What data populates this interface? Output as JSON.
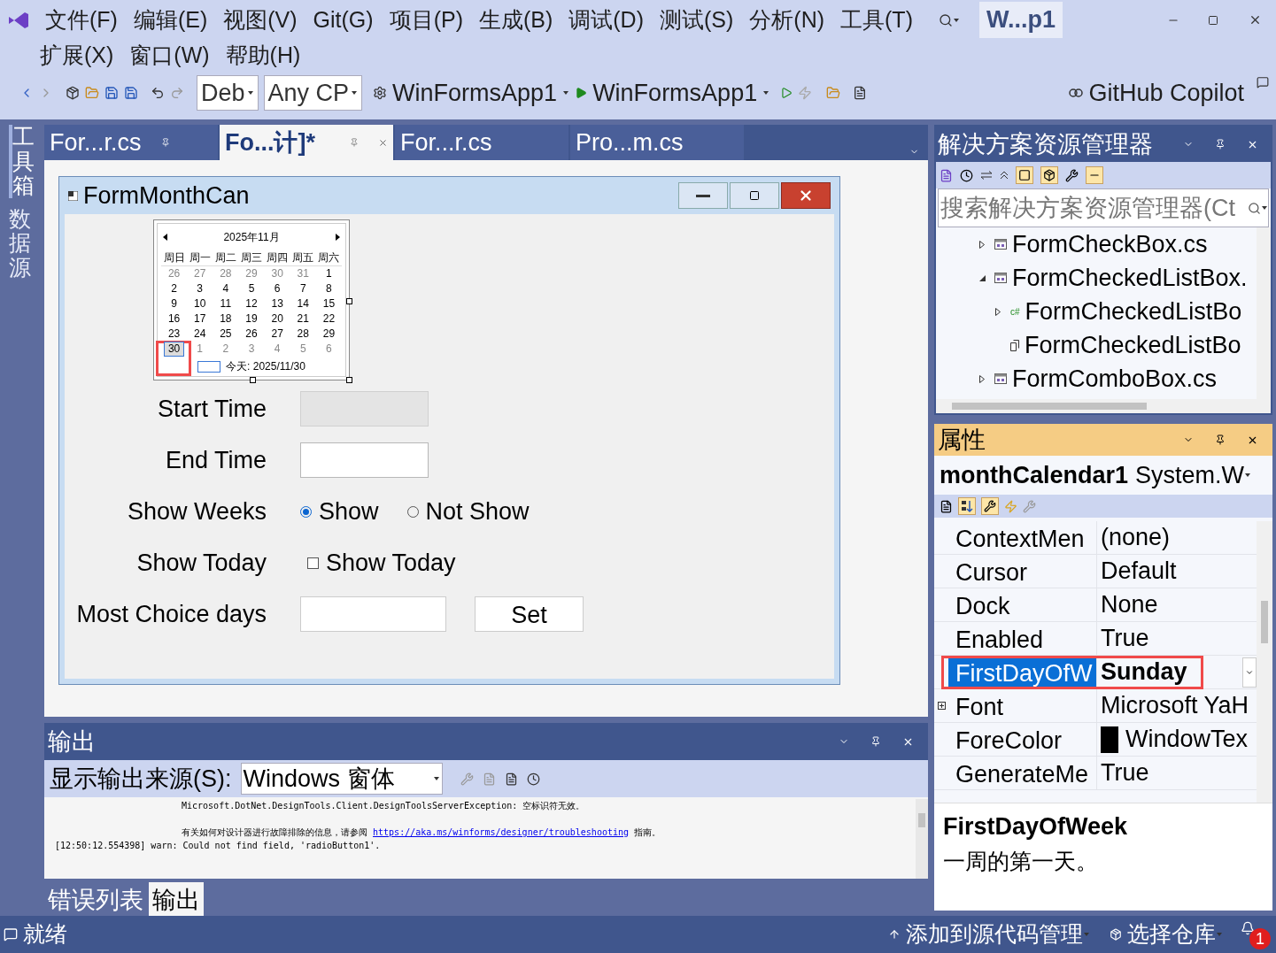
{
  "menu_rows": [
    [
      "文件(F)",
      "编辑(E)",
      "视图(V)",
      "Git(G)",
      "项目(P)",
      "生成(B)",
      "调试(D)",
      "测试(S)",
      "分析(N)",
      "工具(T)"
    ],
    [
      "扩展(X)",
      "窗口(W)",
      "帮助(H)"
    ]
  ],
  "window_title": "W...p1",
  "toolbar": {
    "configuration": "Deb",
    "platform": "Any CP",
    "startup_project": "WinFormsApp1",
    "run_target": "WinFormsApp1",
    "copilot": "GitHub Copilot"
  },
  "side_tabs": [
    {
      "label": "工具箱",
      "selected": true
    },
    {
      "label": "数据源",
      "selected": false
    }
  ],
  "editor_tabs": [
    {
      "label": "For...r.cs",
      "selected": false,
      "pinned": true
    },
    {
      "label": "Fo...计]*",
      "selected": true,
      "pinned": false
    },
    {
      "label": "For...r.cs",
      "selected": false,
      "pinned": false
    },
    {
      "label": "Pro...m.cs",
      "selected": false,
      "pinned": false
    }
  ],
  "designer": {
    "form_title": "FormMonthCan",
    "calendar": {
      "month": "2025年11月",
      "weekdays": [
        "周日",
        "周一",
        "周二",
        "周三",
        "周四",
        "周五",
        "周六"
      ],
      "weeks": [
        [
          {
            "d": "26",
            "muted": true,
            "selected": false,
            "highlighted": false
          },
          {
            "d": "27",
            "muted": true,
            "selected": false,
            "highlighted": false
          },
          {
            "d": "28",
            "muted": true,
            "selected": false,
            "highlighted": false
          },
          {
            "d": "29",
            "muted": true,
            "selected": false,
            "highlighted": false
          },
          {
            "d": "30",
            "muted": true,
            "selected": false,
            "highlighted": false
          },
          {
            "d": "31",
            "muted": true,
            "selected": false,
            "highlighted": false
          },
          {
            "d": "1",
            "muted": false,
            "selected": false,
            "highlighted": false
          }
        ],
        [
          {
            "d": "2",
            "muted": false,
            "selected": false,
            "highlighted": false
          },
          {
            "d": "3",
            "muted": false,
            "selected": false,
            "highlighted": false
          },
          {
            "d": "4",
            "muted": false,
            "selected": false,
            "highlighted": false
          },
          {
            "d": "5",
            "muted": false,
            "selected": false,
            "highlighted": false
          },
          {
            "d": "6",
            "muted": false,
            "selected": false,
            "highlighted": false
          },
          {
            "d": "7",
            "muted": false,
            "selected": false,
            "highlighted": false
          },
          {
            "d": "8",
            "muted": false,
            "selected": false,
            "highlighted": false
          }
        ],
        [
          {
            "d": "9",
            "muted": false,
            "selected": false,
            "highlighted": false
          },
          {
            "d": "10",
            "muted": false,
            "selected": false,
            "highlighted": false
          },
          {
            "d": "11",
            "muted": false,
            "selected": false,
            "highlighted": false
          },
          {
            "d": "12",
            "muted": false,
            "selected": false,
            "highlighted": false
          },
          {
            "d": "13",
            "muted": false,
            "selected": false,
            "highlighted": false
          },
          {
            "d": "14",
            "muted": false,
            "selected": false,
            "highlighted": false
          },
          {
            "d": "15",
            "muted": false,
            "selected": false,
            "highlighted": false
          }
        ],
        [
          {
            "d": "16",
            "muted": false,
            "selected": false,
            "highlighted": false
          },
          {
            "d": "17",
            "muted": false,
            "selected": false,
            "highlighted": false
          },
          {
            "d": "18",
            "muted": false,
            "selected": false,
            "highlighted": false
          },
          {
            "d": "19",
            "muted": false,
            "selected": false,
            "highlighted": false
          },
          {
            "d": "20",
            "muted": false,
            "selected": false,
            "highlighted": false
          },
          {
            "d": "21",
            "muted": false,
            "selected": false,
            "highlighted": false
          },
          {
            "d": "22",
            "muted": false,
            "selected": false,
            "highlighted": false
          }
        ],
        [
          {
            "d": "23",
            "muted": false,
            "selected": false,
            "highlighted": false
          },
          {
            "d": "24",
            "muted": false,
            "selected": false,
            "highlighted": false
          },
          {
            "d": "25",
            "muted": false,
            "selected": false,
            "highlighted": false
          },
          {
            "d": "26",
            "muted": false,
            "selected": false,
            "highlighted": false
          },
          {
            "d": "27",
            "muted": false,
            "selected": false,
            "highlighted": false
          },
          {
            "d": "28",
            "muted": false,
            "selected": false,
            "highlighted": false
          },
          {
            "d": "29",
            "muted": false,
            "selected": false,
            "highlighted": false
          }
        ],
        [
          {
            "d": "30",
            "muted": false,
            "selected": true,
            "highlighted": true
          },
          {
            "d": "1",
            "muted": true,
            "selected": false,
            "highlighted": false
          },
          {
            "d": "2",
            "muted": true,
            "selected": false,
            "highlighted": false
          },
          {
            "d": "3",
            "muted": true,
            "selected": false,
            "highlighted": false
          },
          {
            "d": "4",
            "muted": true,
            "selected": false,
            "highlighted": false
          },
          {
            "d": "5",
            "muted": true,
            "selected": false,
            "highlighted": false
          },
          {
            "d": "6",
            "muted": true,
            "selected": false,
            "highlighted": false
          }
        ]
      ],
      "today_label": "今天: 2025/11/30"
    },
    "rows": [
      {
        "kind": "field",
        "label": "Start Time",
        "disabled": true
      },
      {
        "kind": "field",
        "label": "End Time",
        "disabled": false
      },
      {
        "kind": "radio",
        "label": "Show Weeks",
        "options": [
          {
            "label": "Show",
            "selected": true
          },
          {
            "label": "Not Show",
            "selected": false
          }
        ]
      },
      {
        "kind": "checkbox",
        "label": "Show Today",
        "option": "Show Today",
        "checked": false
      },
      {
        "kind": "field_button",
        "label": "Most Choice days",
        "button": "Set"
      }
    ]
  },
  "output": {
    "title": "输出",
    "source_label": "显示输出来源(S):",
    "source": "Windows 窗体",
    "lines": [
      {
        "text": "Microsoft.DotNet.DesignTools.Client.DesignToolsServerException: 空标识符无效。",
        "kind": "message"
      },
      {
        "text": "有关如何对设计器进行故障排除的信息，请参阅",
        "link": "https://aka.ms/winforms/designer/troubleshooting",
        "after": "指南。",
        "kind": "message"
      },
      {
        "text": "[12:50:12.554398] warn: Could not find field, 'radioButton1'.",
        "kind": "log"
      }
    ]
  },
  "bottom_tabs": [
    {
      "label": "错误列表",
      "selected": false
    },
    {
      "label": "输出",
      "selected": true
    }
  ],
  "solution_explorer": {
    "title": "解决方案资源管理器",
    "search_placeholder": "搜索解决方案资源管理器(Ct",
    "tree": [
      {
        "label": "FormCheckBox.cs",
        "kind": "form",
        "expanded": false
      },
      {
        "label": "FormCheckedListBox.",
        "kind": "form",
        "expanded": true,
        "children": [
          {
            "label": "FormCheckedListBo",
            "kind": "code",
            "badge": "c#",
            "expanded": false
          },
          {
            "label": "FormCheckedListBo",
            "kind": "resource"
          }
        ]
      },
      {
        "label": "FormComboBox.cs",
        "kind": "form",
        "expanded": false
      }
    ]
  },
  "properties": {
    "title": "属性",
    "object": "monthCalendar1",
    "type": "System.W",
    "rows": [
      {
        "name": "ContextMen",
        "value": "(none)",
        "selected": false,
        "modified": false,
        "highlighted": false,
        "expandable": false
      },
      {
        "name": "Cursor",
        "value": "Default",
        "selected": false,
        "modified": false,
        "highlighted": false,
        "expandable": false
      },
      {
        "name": "Dock",
        "value": "None",
        "selected": false,
        "modified": false,
        "highlighted": false,
        "expandable": false
      },
      {
        "name": "Enabled",
        "value": "True",
        "selected": false,
        "modified": false,
        "highlighted": false,
        "expandable": false
      },
      {
        "name": "FirstDayOfW",
        "value": "Sunday",
        "selected": true,
        "modified": true,
        "highlighted": true,
        "expandable": false
      },
      {
        "name": "Font",
        "value": "Microsoft YaH",
        "selected": false,
        "modified": false,
        "highlighted": false,
        "expandable": true
      },
      {
        "name": "ForeColor",
        "value": "WindowTex",
        "selected": false,
        "modified": false,
        "highlighted": false,
        "expandable": false,
        "color": "#000000"
      },
      {
        "name": "GenerateMe",
        "value": "True",
        "selected": false,
        "modified": false,
        "highlighted": false,
        "expandable": false
      }
    ],
    "description_title": "FirstDayOfWeek",
    "description": "一周的第一天。"
  },
  "status": {
    "text": "就绪",
    "source_control": "添加到源代码管理",
    "repository": "选择仓库",
    "notifications": "1"
  }
}
